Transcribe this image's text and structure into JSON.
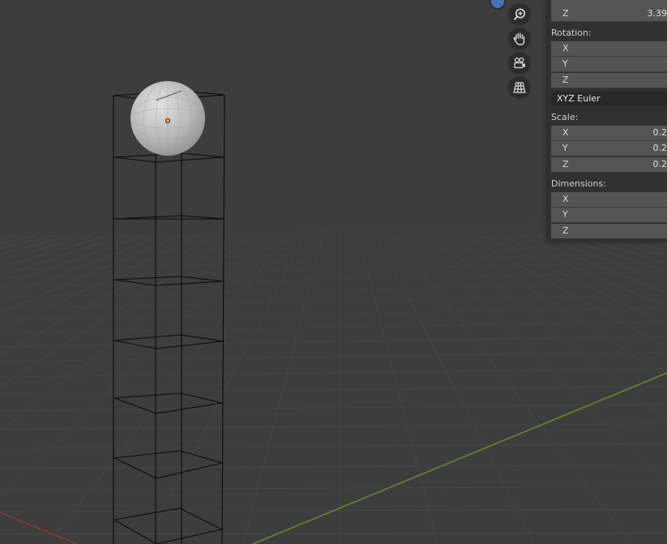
{
  "viewport": {
    "grid_color": "#474747",
    "x_axis_color": "#8a3a3a",
    "y_axis_color": "#6e8a2a",
    "sphere_origin_color": "#f5a020"
  },
  "nav_gizmo": [
    {
      "name": "zoom",
      "icon": "zoom-icon"
    },
    {
      "name": "pan",
      "icon": "hand-icon"
    },
    {
      "name": "camera",
      "icon": "camera-icon"
    },
    {
      "name": "perspective",
      "icon": "grid-icon"
    }
  ],
  "panel": {
    "location": {
      "z": {
        "axis": "Z",
        "value": "3.39"
      }
    },
    "rotation": {
      "label": "Rotation:",
      "x": {
        "axis": "X",
        "value": ""
      },
      "y": {
        "axis": "Y",
        "value": ""
      },
      "z": {
        "axis": "Z",
        "value": ""
      },
      "mode": "XYZ Euler"
    },
    "scale": {
      "label": "Scale:",
      "x": {
        "axis": "X",
        "value": "0.2"
      },
      "y": {
        "axis": "Y",
        "value": "0.2"
      },
      "z": {
        "axis": "Z",
        "value": "0.2"
      }
    },
    "dimensions": {
      "label": "Dimensions:",
      "x": {
        "axis": "X",
        "value": ""
      },
      "y": {
        "axis": "Y",
        "value": ""
      },
      "z": {
        "axis": "Z",
        "value": ""
      }
    }
  }
}
